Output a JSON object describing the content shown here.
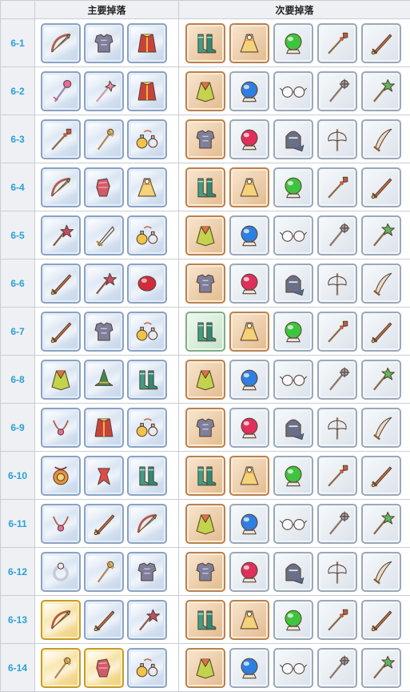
{
  "header": {
    "primary_label": "主要掉落",
    "secondary_label": "次要掉落"
  },
  "colors": {
    "stage_text": "#2aa0d8",
    "header_bg": "#eef0f3",
    "border": "#c9cdd4"
  },
  "rows": [
    {
      "stage": "6-1",
      "primary": [
        {
          "icon": "bow-icon",
          "frame": "blue"
        },
        {
          "icon": "armor-icon",
          "frame": "blue"
        },
        {
          "icon": "robe-icon",
          "frame": "blue"
        }
      ],
      "secondary": [
        {
          "icon": "boots-icon",
          "frame": "copper"
        },
        {
          "icon": "dress-icon",
          "frame": "copper"
        },
        {
          "icon": "orb-icon",
          "frame": "silver",
          "color": "#3ec43e"
        },
        {
          "icon": "spear-icon",
          "frame": "silver"
        },
        {
          "icon": "sword-icon",
          "frame": "silver"
        }
      ]
    },
    {
      "stage": "6-2",
      "primary": [
        {
          "icon": "staff-icon",
          "frame": "blue"
        },
        {
          "icon": "wand-icon",
          "frame": "blue"
        },
        {
          "icon": "robe-icon",
          "frame": "blue"
        }
      ],
      "secondary": [
        {
          "icon": "cloak-icon",
          "frame": "copper"
        },
        {
          "icon": "orb-icon",
          "frame": "silver",
          "color": "#2f7fe0"
        },
        {
          "icon": "glasses-icon",
          "frame": "silver"
        },
        {
          "icon": "mace-icon",
          "frame": "silver"
        },
        {
          "icon": "leaf-staff-icon",
          "frame": "silver"
        }
      ]
    },
    {
      "stage": "6-3",
      "primary": [
        {
          "icon": "spear-icon",
          "frame": "blue"
        },
        {
          "icon": "scepter-icon",
          "frame": "blue"
        },
        {
          "icon": "potion-icon",
          "frame": "blue"
        }
      ],
      "secondary": [
        {
          "icon": "armor-icon",
          "frame": "copper"
        },
        {
          "icon": "orb-icon",
          "frame": "silver",
          "color": "#e02f5a"
        },
        {
          "icon": "helmet-icon",
          "frame": "silver"
        },
        {
          "icon": "axe-icon",
          "frame": "silver"
        },
        {
          "icon": "scimitar-icon",
          "frame": "silver"
        }
      ]
    },
    {
      "stage": "6-4",
      "primary": [
        {
          "icon": "bow-icon",
          "frame": "blue"
        },
        {
          "icon": "gauntlet-icon",
          "frame": "blue"
        },
        {
          "icon": "dress-icon",
          "frame": "blue"
        }
      ],
      "secondary": [
        {
          "icon": "boots-icon",
          "frame": "copper"
        },
        {
          "icon": "dress-icon",
          "frame": "copper"
        },
        {
          "icon": "orb-icon",
          "frame": "silver",
          "color": "#3ec43e"
        },
        {
          "icon": "spear-icon",
          "frame": "silver"
        },
        {
          "icon": "sword-icon",
          "frame": "silver"
        }
      ]
    },
    {
      "stage": "6-5",
      "primary": [
        {
          "icon": "flower-staff-icon",
          "frame": "blue"
        },
        {
          "icon": "dagger-icon",
          "frame": "blue"
        },
        {
          "icon": "potion-icon",
          "frame": "blue"
        }
      ],
      "secondary": [
        {
          "icon": "cloak-icon",
          "frame": "copper"
        },
        {
          "icon": "orb-icon",
          "frame": "silver",
          "color": "#2f7fe0"
        },
        {
          "icon": "glasses-icon",
          "frame": "silver"
        },
        {
          "icon": "mace-icon",
          "frame": "silver"
        },
        {
          "icon": "leaf-staff-icon",
          "frame": "silver"
        }
      ]
    },
    {
      "stage": "6-6",
      "primary": [
        {
          "icon": "sword-icon",
          "frame": "blue"
        },
        {
          "icon": "flower-staff-icon",
          "frame": "blue"
        },
        {
          "icon": "gem-icon",
          "frame": "blue"
        }
      ],
      "secondary": [
        {
          "icon": "armor-icon",
          "frame": "copper"
        },
        {
          "icon": "orb-icon",
          "frame": "silver",
          "color": "#e02f5a"
        },
        {
          "icon": "helmet-icon",
          "frame": "silver"
        },
        {
          "icon": "axe-icon",
          "frame": "silver"
        },
        {
          "icon": "scimitar-icon",
          "frame": "silver"
        }
      ]
    },
    {
      "stage": "6-7",
      "primary": [
        {
          "icon": "sword-icon",
          "frame": "blue"
        },
        {
          "icon": "armor-icon",
          "frame": "blue"
        },
        {
          "icon": "potion-icon",
          "frame": "blue"
        }
      ],
      "secondary": [
        {
          "icon": "boots-icon",
          "frame": "green"
        },
        {
          "icon": "dress-icon",
          "frame": "copper"
        },
        {
          "icon": "orb-icon",
          "frame": "silver",
          "color": "#3ec43e"
        },
        {
          "icon": "spear-icon",
          "frame": "silver"
        },
        {
          "icon": "sword-icon",
          "frame": "silver"
        }
      ]
    },
    {
      "stage": "6-8",
      "primary": [
        {
          "icon": "cloak-icon",
          "frame": "blue"
        },
        {
          "icon": "hat-icon",
          "frame": "blue"
        },
        {
          "icon": "boots-icon",
          "frame": "blue"
        }
      ],
      "secondary": [
        {
          "icon": "cloak-icon",
          "frame": "copper"
        },
        {
          "icon": "orb-icon",
          "frame": "silver",
          "color": "#2f7fe0"
        },
        {
          "icon": "glasses-icon",
          "frame": "silver"
        },
        {
          "icon": "mace-icon",
          "frame": "silver"
        },
        {
          "icon": "leaf-staff-icon",
          "frame": "silver"
        }
      ]
    },
    {
      "stage": "6-9",
      "primary": [
        {
          "icon": "necklace-icon",
          "frame": "blue"
        },
        {
          "icon": "robe-icon",
          "frame": "blue"
        },
        {
          "icon": "potion-icon",
          "frame": "blue"
        }
      ],
      "secondary": [
        {
          "icon": "armor-icon",
          "frame": "copper"
        },
        {
          "icon": "orb-icon",
          "frame": "silver",
          "color": "#e02f5a"
        },
        {
          "icon": "helmet-icon",
          "frame": "silver"
        },
        {
          "icon": "axe-icon",
          "frame": "silver"
        },
        {
          "icon": "scimitar-icon",
          "frame": "silver"
        }
      ]
    },
    {
      "stage": "6-10",
      "primary": [
        {
          "icon": "amulet-icon",
          "frame": "blue"
        },
        {
          "icon": "ribbon-icon",
          "frame": "blue"
        },
        {
          "icon": "boots-icon",
          "frame": "blue"
        }
      ],
      "secondary": [
        {
          "icon": "boots-icon",
          "frame": "copper"
        },
        {
          "icon": "dress-icon",
          "frame": "copper"
        },
        {
          "icon": "orb-icon",
          "frame": "silver",
          "color": "#3ec43e"
        },
        {
          "icon": "spear-icon",
          "frame": "silver"
        },
        {
          "icon": "sword-icon",
          "frame": "silver"
        }
      ]
    },
    {
      "stage": "6-11",
      "primary": [
        {
          "icon": "necklace-icon",
          "frame": "blue"
        },
        {
          "icon": "sword-icon",
          "frame": "blue"
        },
        {
          "icon": "bow-icon",
          "frame": "blue"
        }
      ],
      "secondary": [
        {
          "icon": "cloak-icon",
          "frame": "copper"
        },
        {
          "icon": "orb-icon",
          "frame": "silver",
          "color": "#2f7fe0"
        },
        {
          "icon": "glasses-icon",
          "frame": "silver"
        },
        {
          "icon": "mace-icon",
          "frame": "silver"
        },
        {
          "icon": "leaf-staff-icon",
          "frame": "silver"
        }
      ]
    },
    {
      "stage": "6-12",
      "primary": [
        {
          "icon": "ring-icon",
          "frame": "blue"
        },
        {
          "icon": "scepter-icon",
          "frame": "blue"
        },
        {
          "icon": "armor-icon",
          "frame": "blue"
        }
      ],
      "secondary": [
        {
          "icon": "armor-icon",
          "frame": "copper"
        },
        {
          "icon": "orb-icon",
          "frame": "silver",
          "color": "#e02f5a"
        },
        {
          "icon": "helmet-icon",
          "frame": "silver"
        },
        {
          "icon": "axe-icon",
          "frame": "silver"
        },
        {
          "icon": "scimitar-icon",
          "frame": "silver"
        }
      ]
    },
    {
      "stage": "6-13",
      "primary": [
        {
          "icon": "bow-icon",
          "frame": "gold"
        },
        {
          "icon": "sword-icon",
          "frame": "blue"
        },
        {
          "icon": "flower-staff-icon",
          "frame": "blue"
        }
      ],
      "secondary": [
        {
          "icon": "boots-icon",
          "frame": "copper"
        },
        {
          "icon": "dress-icon",
          "frame": "copper"
        },
        {
          "icon": "orb-icon",
          "frame": "silver",
          "color": "#3ec43e"
        },
        {
          "icon": "spear-icon",
          "frame": "silver"
        },
        {
          "icon": "sword-icon",
          "frame": "silver"
        }
      ]
    },
    {
      "stage": "6-14",
      "primary": [
        {
          "icon": "scepter-icon",
          "frame": "gold"
        },
        {
          "icon": "gauntlet-icon",
          "frame": "gold"
        },
        {
          "icon": "potion-icon",
          "frame": "blue"
        }
      ],
      "secondary": [
        {
          "icon": "cloak-icon",
          "frame": "copper"
        },
        {
          "icon": "orb-icon",
          "frame": "silver",
          "color": "#2f7fe0"
        },
        {
          "icon": "glasses-icon",
          "frame": "silver"
        },
        {
          "icon": "mace-icon",
          "frame": "silver"
        },
        {
          "icon": "leaf-staff-icon",
          "frame": "silver"
        }
      ]
    }
  ]
}
